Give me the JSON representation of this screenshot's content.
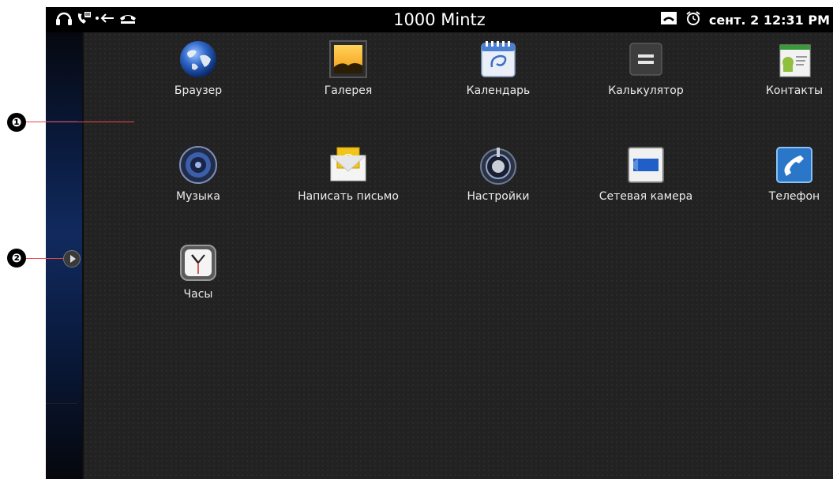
{
  "status_bar": {
    "title": "1000  Mintz",
    "datetime": "сент. 2 12:31 PM",
    "left_icons": [
      "headset-icon",
      "voicemail-icon",
      "call-forward-icon",
      "phone-hangup-icon"
    ],
    "right_icons": [
      "handset-icon",
      "alarm-clock-icon"
    ]
  },
  "callouts": {
    "first": "❶",
    "second": "❷"
  },
  "apps": [
    {
      "label": "Браузер",
      "icon": "globe-icon"
    },
    {
      "label": "Галерея",
      "icon": "gallery-icon"
    },
    {
      "label": "Календарь",
      "icon": "calendar-icon"
    },
    {
      "label": "Калькулятор",
      "icon": "calculator-icon"
    },
    {
      "label": "Контакты",
      "icon": "contacts-icon"
    },
    {
      "label": "Музыка",
      "icon": "speaker-icon"
    },
    {
      "label": "Написать письмо",
      "icon": "email-icon"
    },
    {
      "label": "Настройки",
      "icon": "settings-icon"
    },
    {
      "label": "Сетевая камера",
      "icon": "camera-icon"
    },
    {
      "label": "Телефон",
      "icon": "phone-icon"
    },
    {
      "label": "Часы",
      "icon": "clock-icon"
    }
  ],
  "colors": {
    "callout_line": "#e8484e",
    "drawer_bg": "#222222",
    "phone_blue": "#2a76c9"
  }
}
